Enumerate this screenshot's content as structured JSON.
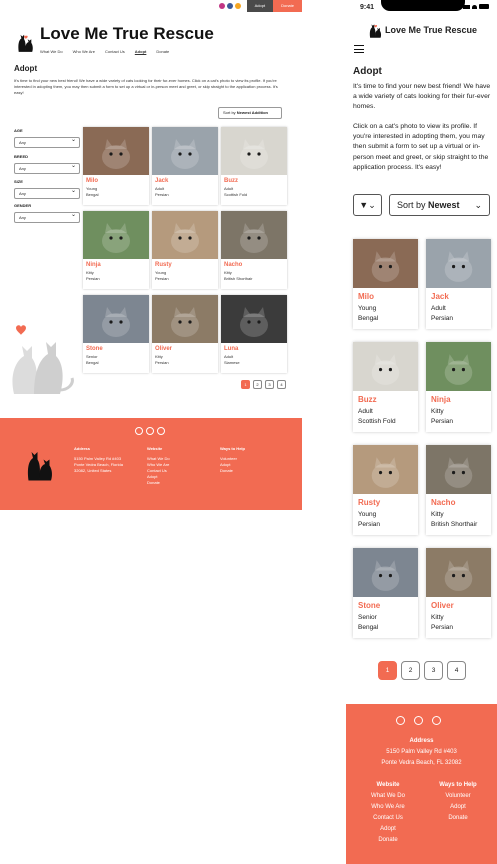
{
  "brand": {
    "accent": "#f26b52",
    "title": "Love Me True Rescue"
  },
  "topbar": {
    "social_icons": [
      "instagram-icon",
      "facebook-icon",
      "petfinder-icon"
    ],
    "adopt_label": "Adopt",
    "donate_label": "Donate"
  },
  "nav": {
    "items": [
      "What We Do",
      "Who We Are",
      "Contact Us",
      "Adopt",
      "Donate"
    ],
    "active": "Adopt"
  },
  "page": {
    "heading": "Adopt",
    "intro": "It's time to find your new best friend! We have a wide variety of cats looking for their fur-ever homes. Click on a cat's photo to view its profile. If you're interested in adopting them, you may then submit a form to set up a virtual or in-person meet and greet, or skip straight to the application process. It's easy!",
    "mobile_intro_1": "It's time to find your new best friend! We have a wide variety of cats looking for their fur-ever homes.",
    "mobile_intro_2": "Click on a cat's photo to view its profile. If you're interested in adopting them, you may then submit a form to set up a virtual or in-person meet and greet, or skip straight to the application process.  It's easy!"
  },
  "sort": {
    "prefix": "Sort by",
    "desktop_value": "Newest Addition",
    "mobile_value": "Newest"
  },
  "filters": [
    {
      "label": "AGE",
      "value": "Any"
    },
    {
      "label": "BREED",
      "value": "Any"
    },
    {
      "label": "SIZE",
      "value": "Any"
    },
    {
      "label": "GENDER",
      "value": "Any"
    }
  ],
  "cats": [
    {
      "name": "Milo",
      "age": "Young",
      "breed": "Bengal",
      "photo": "#8a6a55"
    },
    {
      "name": "Jack",
      "age": "Adult",
      "breed": "Persian",
      "photo": "#9aa3ab"
    },
    {
      "name": "Buzz",
      "age": "Adult",
      "breed": "Scottish Fold",
      "photo": "#d8d6cf"
    },
    {
      "name": "Ninja",
      "age": "Kitty",
      "breed": "Persian",
      "photo": "#6f8f5f"
    },
    {
      "name": "Rusty",
      "age": "Young",
      "breed": "Persian",
      "photo": "#b59a7d"
    },
    {
      "name": "Nacho",
      "age": "Kitty",
      "breed": "British Shorthair",
      "photo": "#7d7567"
    },
    {
      "name": "Stone",
      "age": "Senior",
      "breed": "Bengal",
      "photo": "#7d8691"
    },
    {
      "name": "Oliver",
      "age": "Kitty",
      "breed": "Persian",
      "photo": "#8c7b66"
    },
    {
      "name": "Luna",
      "age": "Adult",
      "breed": "Siamese",
      "photo": "#3b3b3b"
    }
  ],
  "pagination": {
    "pages": [
      "1",
      "2",
      "3",
      "4"
    ],
    "current": "1"
  },
  "footer": {
    "address_title": "Address",
    "address_lines_desktop": [
      "5150 Palm Valley Rd #403",
      "Ponte Vedra Beach, Florida",
      "32082, United States"
    ],
    "address_lines_mobile": [
      "5150 Palm Valley Rd #403",
      "Ponte Vedra Beach, FL 32082"
    ],
    "website_title": "Website",
    "website_links": [
      "What We Do",
      "Who We Are",
      "Contact Us",
      "Adopt",
      "Donate"
    ],
    "help_title": "Ways to Help",
    "help_links": [
      "Volunteer",
      "Adopt",
      "Donate"
    ]
  },
  "status_bar": {
    "time": "9:41"
  }
}
